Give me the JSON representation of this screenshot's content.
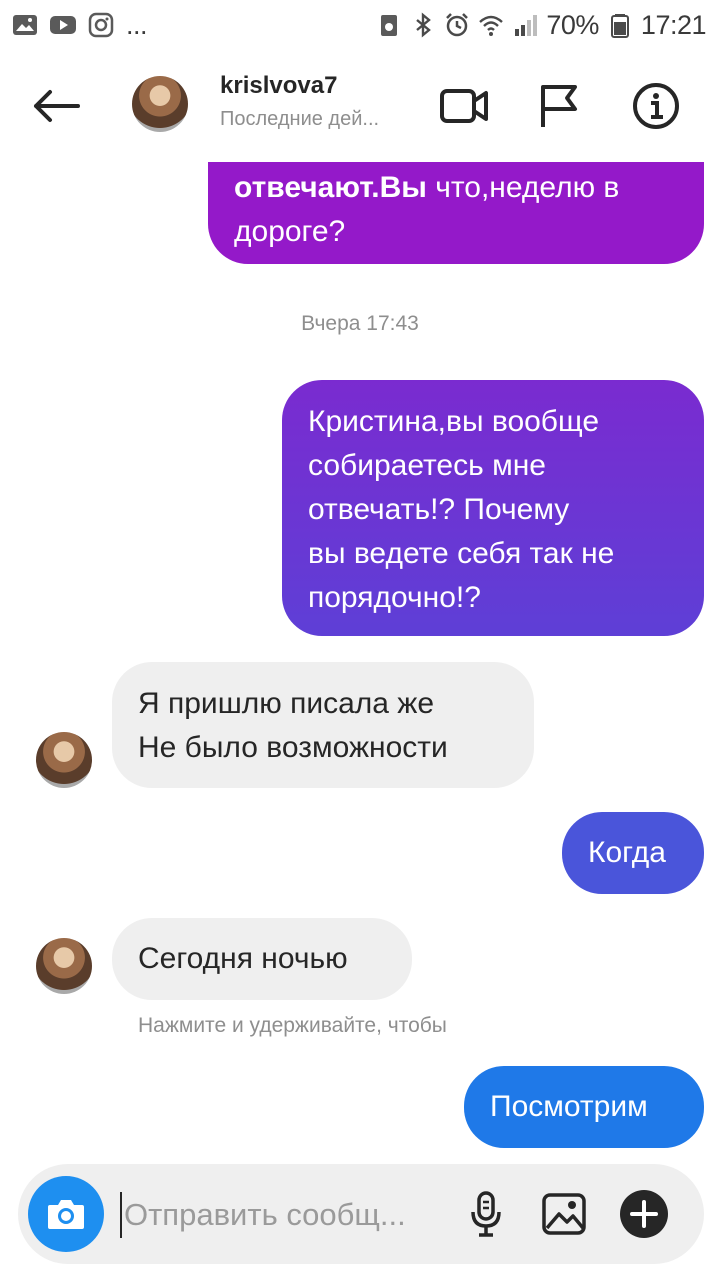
{
  "status_bar": {
    "battery": "70%",
    "time": "17:21",
    "more": "..."
  },
  "header": {
    "username": "krislvova7",
    "activity": "Последние дей..."
  },
  "messages": {
    "m1_bold": "отвечают.Вы",
    "m1_rest": " что,неделю в",
    "m1_line2": "дороге?",
    "timestamp": "Вчера 17:43",
    "m2": [
      "Кристина,вы вообще",
      "собираетесь мне",
      "отвечать!? Почему",
      "вы ведете себя так не",
      "порядочно!?"
    ],
    "m3": [
      "Я пришлю писала же",
      "Не было возможности"
    ],
    "m4": "Когда",
    "m5": "Сегодня ночью",
    "hint": "Нажмите и удерживайте, чтобы",
    "m6": "Посмотрим"
  },
  "composer": {
    "placeholder": "Отправить сообщ..."
  },
  "colors": {
    "bubble_purple": "#9419c9",
    "bubble_violet": "#6b38d2",
    "bubble_blue": "#4a55da",
    "bubble_sky": "#1f79e8",
    "received_bg": "#efefef",
    "camera": "#1e8ff0"
  },
  "icons": [
    "gallery-icon",
    "youtube-icon",
    "instagram-icon",
    "alarm-icon",
    "bluetooth-icon",
    "wifi-icon",
    "signal-icon",
    "battery-icon",
    "back-arrow-icon",
    "video-call-icon",
    "flag-icon",
    "info-icon",
    "camera-icon",
    "microphone-icon",
    "image-icon",
    "plus-icon"
  ]
}
